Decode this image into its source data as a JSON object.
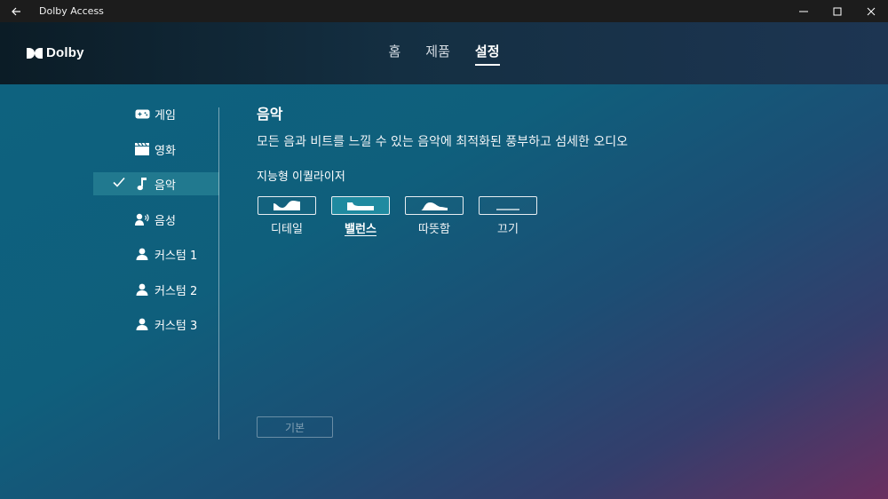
{
  "window": {
    "title": "Dolby Access",
    "back_icon": "back-arrow-icon"
  },
  "header": {
    "logo_text": "Dolby",
    "nav": [
      {
        "label": "홈",
        "active": false
      },
      {
        "label": "제품",
        "active": false
      },
      {
        "label": "설정",
        "active": true
      }
    ]
  },
  "sidebar": {
    "items": [
      {
        "label": "게임",
        "icon": "gamepad-icon",
        "selected": false
      },
      {
        "label": "영화",
        "icon": "clapperboard-icon",
        "selected": false
      },
      {
        "label": "음악",
        "icon": "music-note-icon",
        "selected": true
      },
      {
        "label": "음성",
        "icon": "voice-icon",
        "selected": false
      },
      {
        "label": "커스텀 1",
        "icon": "person-icon",
        "selected": false
      },
      {
        "label": "커스텀 2",
        "icon": "person-icon",
        "selected": false
      },
      {
        "label": "커스텀 3",
        "icon": "person-icon",
        "selected": false
      }
    ]
  },
  "content": {
    "title": "음악",
    "description": "모든 음과 비트를 느낄 수 있는 음악에 최적화된 풍부하고 섬세한 오디오",
    "equalizer_title": "지능형 이퀄라이저",
    "presets": [
      {
        "label": "디테일",
        "icon": "eq-detail-icon",
        "active": false
      },
      {
        "label": "밸런스",
        "icon": "eq-balanced-icon",
        "active": true
      },
      {
        "label": "따뜻함",
        "icon": "eq-warm-icon",
        "active": false
      },
      {
        "label": "끄기",
        "icon": "eq-off-icon",
        "active": false
      }
    ],
    "default_button": "기본"
  },
  "colors": {
    "titlebar": "#1c1c1c",
    "selected_item": "#288296",
    "active_preset": "#1f8aa0"
  }
}
